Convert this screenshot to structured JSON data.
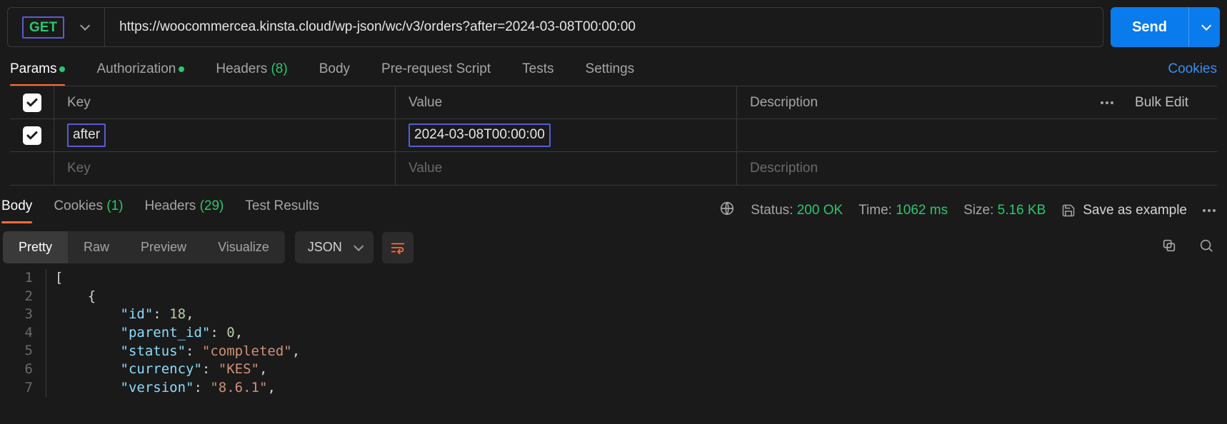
{
  "request": {
    "method": "GET",
    "url": "https://woocommercea.kinsta.cloud/wp-json/wc/v3/orders?after=2024-03-08T00:00:00",
    "send_label": "Send"
  },
  "request_tabs": {
    "params": "Params",
    "authorization": "Authorization",
    "headers_label": "Headers",
    "headers_count": "(8)",
    "body": "Body",
    "prerequest": "Pre-request Script",
    "tests": "Tests",
    "settings": "Settings",
    "cookies": "Cookies"
  },
  "params_table": {
    "header_key": "Key",
    "header_value": "Value",
    "header_description": "Description",
    "bulk_edit": "Bulk Edit",
    "rows": [
      {
        "key": "after",
        "value": "2024-03-08T00:00:00",
        "description": ""
      }
    ],
    "placeholder_key": "Key",
    "placeholder_value": "Value",
    "placeholder_description": "Description"
  },
  "response_tabs": {
    "body": "Body",
    "cookies_label": "Cookies",
    "cookies_count": "(1)",
    "headers_label": "Headers",
    "headers_count": "(29)",
    "test_results": "Test Results"
  },
  "response_meta": {
    "status_label": "Status:",
    "status_value": "200 OK",
    "time_label": "Time:",
    "time_value": "1062 ms",
    "size_label": "Size:",
    "size_value": "5.16 KB",
    "save_example": "Save as example"
  },
  "body_toolbar": {
    "pretty": "Pretty",
    "raw": "Raw",
    "preview": "Preview",
    "visualize": "Visualize",
    "format": "JSON"
  },
  "json_lines": {
    "l1": "[",
    "l2_open": "{",
    "l3_key": "\"id\"",
    "l3_sep": ": ",
    "l3_val": "18",
    "l3_tail": ",",
    "l4_key": "\"parent_id\"",
    "l4_sep": ": ",
    "l4_val": "0",
    "l4_tail": ",",
    "l5_key": "\"status\"",
    "l5_sep": ": ",
    "l5_val": "\"completed\"",
    "l5_tail": ",",
    "l6_key": "\"currency\"",
    "l6_sep": ": ",
    "l6_val": "\"KES\"",
    "l6_tail": ",",
    "l7_key": "\"version\"",
    "l7_sep": ": ",
    "l7_val": "\"8.6.1\"",
    "l7_tail": ","
  }
}
